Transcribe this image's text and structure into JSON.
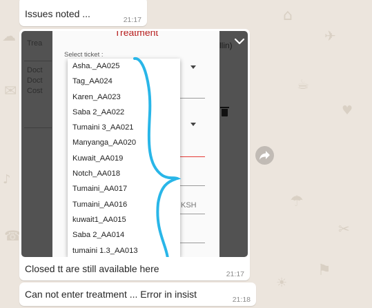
{
  "messages": [
    {
      "text": "Issues noted ...",
      "time": "21:17"
    },
    {
      "caption": "Closed tt are still available here",
      "time": "21:17"
    },
    {
      "text": "Can not enter treatment ... Error in insist",
      "time": "21:18"
    }
  ],
  "screenshot": {
    "title": "Treatment",
    "select_label": "Select ticket :",
    "currency": "KSH",
    "background_fragments": {
      "a": "Trea",
      "b": "Doct",
      "c": "Doct",
      "d": "Cost",
      "e": "S",
      "f": "llin)"
    },
    "options": [
      "Asha._AA025",
      "Tag_AA024",
      "Karen_AA023",
      "Saba 2_AA022",
      "Tumaini  3_AA021",
      "Manyanga_AA020",
      "Kuwait_AA019",
      "Notch_AA018",
      "Tumaini_AA017",
      "Tumaini_AA016",
      "kuwait1_AA015",
      "Saba 2_AA014",
      "tumaini 1.3_AA013"
    ]
  },
  "icons": {
    "collapse": "chevron-down-icon",
    "forward": "forward-arrow-icon",
    "delete": "trash-icon"
  },
  "colors": {
    "background": "#ece5dd",
    "bubble": "#ffffff",
    "scribble": "#29b6e8",
    "title": "#b71c1c"
  }
}
